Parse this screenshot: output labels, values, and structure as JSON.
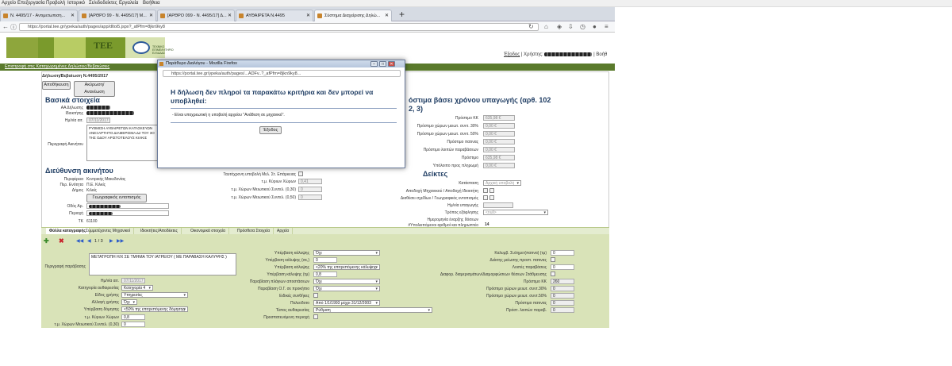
{
  "browser": {
    "menu": [
      "Αρχείο",
      "Επεξεργασία",
      "Προβολή",
      "Ιστορικό",
      "Σελιδοδείκτες",
      "Εργαλεία",
      "Βοήθεια"
    ],
    "tabs": [
      "Ν. 4495/17 - Αντιμετωπιση...",
      "[ΑΡΘΡΟ 99 - Ν. 4495/17] Μ...",
      "[ΑΡΘΡΟ 099 - Ν. 4495/17] Δ...",
      "ΑΥΘΑΙΡΕΤΑ Ν.4495",
      "Σύστημα Διαχείρισης Δηλώ..."
    ],
    "url": "https://portal.tee.gr/ypeka/auth/pages/app/dltoi5.jspx?_afPfm=8jkn9ky8"
  },
  "site": {
    "logo_text": "TEE",
    "logo_sub": "ΤΕΧΝΙΚΟ ΕΠΙΜΕΛΗΤΗΡΙΟ ΕΛΛΑΔΑΣ",
    "exit_link": "Έξοδος",
    "user_label": "Χρήστης:",
    "user_right": "| Βοήθ",
    "back_link": "Επιστροφή στις Καταχωρημένες Δηλώσεις/Βεβαιώσεις"
  },
  "form": {
    "title": "Δήλωση/Βεβαίωση Ν.4495/2017",
    "save_btn": "Αποθήκευση",
    "cancel_btn": "Ακύρωση/Ανανέωση",
    "section_basic": "Βασικά στοιχεία",
    "aa_label": "ΑΑ Δήλωσης",
    "owner_label": "Ιδιοκτήτης",
    "date_label": "Ημ/νία αιτ.",
    "date_value": "07/11/2017",
    "desc_label": "Περιγραφή Ακινήτου",
    "desc_value": "ΡΥΘΜΙΣΗ ΑΥΘΑΙΡΕΤΩΝ ΚΑΤΑΣΚΕΥΩΝ ΑΝΕΞΑΡΤΗΤΟ ΔΙΑΜΕΡΙΣΜΑ Δ2 ΤΟΥ 3Ο ΤΗΣ ΟΔΟΥ ΑΡΙΣΤΟΤΕΛΟΥΣ ΚΙΛΚΙΣ",
    "section_address": "Διεύθυνση ακινήτου",
    "region_label": "Περιφέρεια",
    "region_value": "Κεντρικής Μακεδονίας",
    "unit_label": "Περ. Ενότητα",
    "unit_value": "Π.Ε. Κιλκίς",
    "municipality_label": "Δήμος",
    "municipality_value": "Κιλκίς",
    "geo_btn": "Γεωγραφικός εντοπισμός",
    "street_label": "Οδός Αρ.",
    "area_label": "Περιοχή",
    "tk_label": "ΤΚ",
    "tk_value": "61100",
    "mid_check_label": "Ταυτόχρονη υποβολή Μελ. Στ. Επάρκειας",
    "mid_area_label": "τ.μ. Κύριων Χώρων",
    "mid_area_value": "0,41",
    "mid_coef1_label": "τ.μ. Χώρων Μειωτικού Συντελ. (0,30)",
    "mid_coef1_value": "0",
    "mid_coef2_label": "τ.μ. Χώρων Μειωτικού Συντελ. (0,50)",
    "mid_coef2_value": "0",
    "section_fines": "όστιμα βάσει χρόνου υπαγωγής (αρθ. 102",
    "section_fines2": "2, 3)",
    "fine_rows": [
      {
        "label": "Πρόστιμο ΚΚ",
        "value": "635,98 €"
      },
      {
        "label": "Πρόστιμο χώρων μειωτ. συντ. 30%",
        "value": "0,00 €"
      },
      {
        "label": "Πρόστιμο χώρων μειωτ. συντ. 50%",
        "value": "0,00 €"
      },
      {
        "label": "Πρόστιμο πατινας",
        "value": "0,00 €"
      },
      {
        "label": "Πρόστιμο λοιπών παραβάσεων",
        "value": "0,00 €"
      },
      {
        "label": "Πρόστιμο",
        "value": "635,98 €"
      },
      {
        "label": "Υπόλοιπο προς πληρωμή",
        "value": "0,00 €"
      }
    ],
    "section_indicators": "Δείκτες",
    "status_label": "Κατάσταση",
    "status_value": "Αρχική υποβολή",
    "ind_row1": "Αποδοχή Μηχανικού / Αποδοχή Ιδιοκτήτη",
    "ind_row2": "Διαθέσει σχεδίων / Γεωγραφικός εντοπισμός",
    "ind_row3": "Ημ/νία υπαγωγής",
    "ind_row4": "Τρόπος εξόφλησης",
    "ind_row4_value": "<null>",
    "ind_row5": "Ημερομηνία έναρξης δόσεων",
    "ind_row6": "#Υπολειπόμενοι αριθμοί και πληρωπτέο",
    "ind_row6_value": "14"
  },
  "subtabs": [
    "Φύλλα καταγραφής",
    "Συμμετέχοντες Μηχανικοί",
    "Ιδιοκτήτες/Αποδέκτες",
    "Οικονομικά στοιχεία",
    "Πρόσθετα Στοιχεία",
    "Αρχεία"
  ],
  "record": {
    "pager": "1 / 3",
    "desc_label": "Περιγραφή παράβασης",
    "desc_value": "ΜΕΤΑΤΡΟΠΗ Η/Χ ΣΕ ΤΜΗΜΑ ΤΟΥ ΙΑΤΡΕΙΟΥ ( ΜΕ ΠΑΡΑΒΑΣΗ ΚΑΛΥΨΗΣ )",
    "date_label": "Ημ/νία αιτ.",
    "date_value": "07/11/2017",
    "cat_label": "Κατηγορία αυθαιρεσίας",
    "cat_value": "Κατηγορία 4",
    "use_label": "Είδος χρήσης",
    "use_value": "Υπηρεσίες",
    "change_label": "Αλλαγή χρήσης",
    "change_value": "Όχι",
    "exceed_label": "Υπέρβαση δόμησης",
    "exceed_value": "<50% της επιτρεπόμενης δόμησης",
    "area_label": "τ.μ. Κύριων Χώρων",
    "area_value": "0,8",
    "coef_label": "τ.μ. Χώρων Μειωτικού Συντελ. (0,30)",
    "coef_value": "0",
    "m_rows": [
      {
        "label": "Υπέρβαση κάλυψης",
        "value": "Όχι"
      },
      {
        "label": "Υπέρβαση κάλυψης (σε,)",
        "value": "0"
      },
      {
        "label": "Υπέρβαση κάλυψης",
        "value": "<20% της επιτρεπόμενης κάλυψης"
      },
      {
        "label": "Υπέρβαση κάλυψης (τμ)",
        "value": "0,8"
      },
      {
        "label": "Παραβίαση πλάγιων αποστάσεων",
        "value": "Όχι"
      },
      {
        "label": "Παραβίαση Ο.Γ. σε προκήπιο",
        "value": "Όχι"
      },
      {
        "label": "Ειδικές συνθήκες",
        "value": ""
      },
      {
        "label": "Πολεοδοτο",
        "value": "Από 1/1/1993 μέχρι 31/12/2003"
      },
      {
        "label": "Τύπος αυθαιρεσίας",
        "value": "Ρύθμιση"
      },
      {
        "label": "Προσπατευόμενη περιοχή",
        "value": ""
      }
    ],
    "r_rows": [
      {
        "label": "Καλυμβ. Συλημετ(πατινα) (τμ)",
        "value": "0"
      },
      {
        "label": "Δείκτης μείωσης προστ. πατινας",
        "value": ""
      },
      {
        "label": "Λοιπές παραβάσεις",
        "value": "0"
      },
      {
        "label": "Διαφορ. διαμερισμάτων/Διαμορφώσεων θέσεων Στάθμευσης",
        "value": ""
      },
      {
        "label": "Πρόστιμο ΚΚ",
        "value": "260"
      },
      {
        "label": "Πρόστιμο χώρων μειωτ. συντ.30%",
        "value": "0"
      },
      {
        "label": "Πρόστιμο χώρων μειωτ. συντ.50%",
        "value": "0"
      },
      {
        "label": "Πρόστιμο πατινας",
        "value": "0"
      },
      {
        "label": "Πρόστ. λοιπών παραβ.",
        "value": "0"
      }
    ]
  },
  "dialog": {
    "title": "Παράθυρο Διαλόγου - Mozilla Firefox",
    "url": "https://portal.tee.gr/ypeka/auth/pages/...ADFv..?_afPfm=8jkn9ky8...",
    "heading": "Η δήλωση δεν πληροί τα παρακάτω κριτήρια και δεν μπορεί να υποβληθεί:",
    "message": "- Είναι υποχρεωτική η υποβολή αρχείου \"Ανάθεση σε μηχανικό\".",
    "ok": "Έξοδος"
  }
}
